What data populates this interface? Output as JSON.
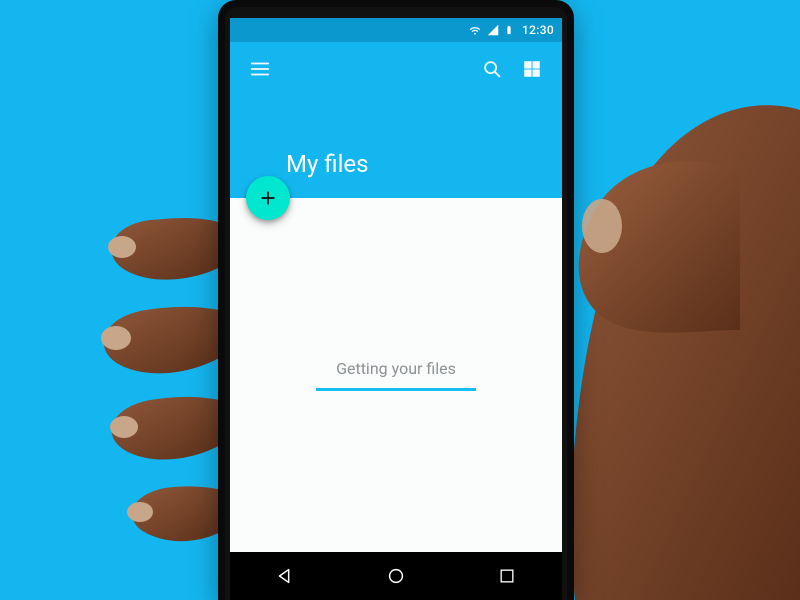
{
  "statusbar": {
    "time": "12:30"
  },
  "appbar": {
    "title": "My files"
  },
  "content": {
    "loading_text": "Getting your files"
  },
  "colors": {
    "background": "#14b6f0",
    "statusbar": "#0a98ce",
    "appbar": "#14b6f0",
    "fab": "#00e6cf",
    "progress": "#18bdf1",
    "skin": "#6b3a20",
    "skin_highlight": "#90583a",
    "nail": "#c8a689"
  }
}
